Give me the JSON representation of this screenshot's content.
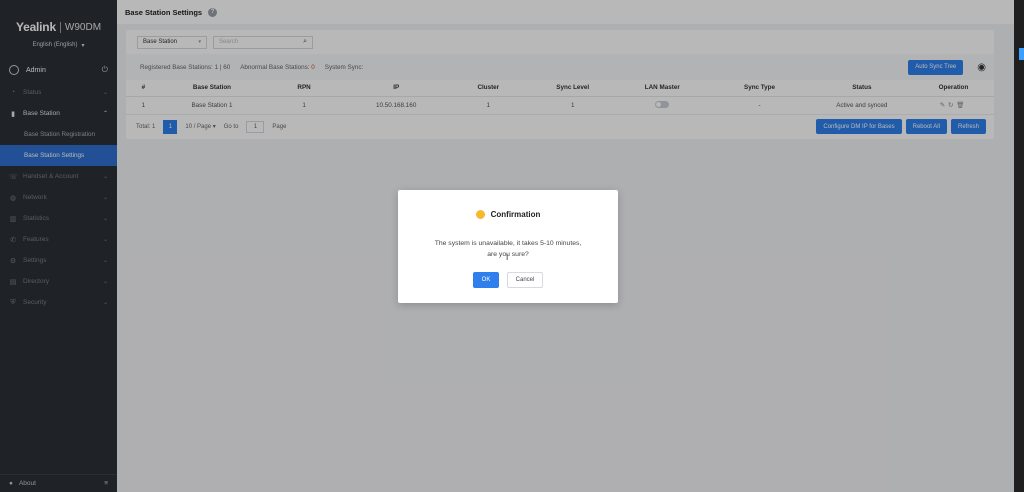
{
  "sidebar": {
    "brand_logo": "Yealink",
    "brand_model": "W90DM",
    "language": "English (English)",
    "user": "Admin",
    "items": [
      {
        "label": "Status",
        "icon": "monitor-icon"
      },
      {
        "label": "Base Station",
        "icon": "base-station-icon"
      },
      {
        "label": "Handset & Account",
        "icon": "phone-icon"
      },
      {
        "label": "Network",
        "icon": "globe-icon"
      },
      {
        "label": "Statistics",
        "icon": "chart-icon"
      },
      {
        "label": "Features",
        "icon": "feature-icon"
      },
      {
        "label": "Settings",
        "icon": "gear-icon"
      },
      {
        "label": "Directory",
        "icon": "book-icon"
      },
      {
        "label": "Security",
        "icon": "shield-icon"
      }
    ],
    "sub_items": [
      "Base Station Registration",
      "Base Station Settings"
    ],
    "about": "About"
  },
  "main": {
    "title": "Base Station Settings",
    "filter_select": "Base Station",
    "search_placeholder": "Search",
    "stats": {
      "registered_label": "Registered Base Stations:",
      "registered_value": "1 | 60",
      "abnormal_label": "Abnormal Base Stations:",
      "abnormal_value": "0",
      "system_sync_label": "System Sync:"
    },
    "auto_sync_button": "Auto Sync Tree",
    "table": {
      "headers": [
        "#",
        "Base Station",
        "RPN",
        "IP",
        "Cluster",
        "Sync Level",
        "LAN Master",
        "Sync Type",
        "Status",
        "Operation"
      ],
      "rows": [
        {
          "num": "1",
          "base_station": "Base Station 1",
          "rpn": "1",
          "ip": "10.50.168.160",
          "cluster": "1",
          "sync_level": "1",
          "sync_type": "-",
          "status": "Active and synced"
        }
      ]
    },
    "pager": {
      "total": "Total: 1",
      "current_page": "1",
      "per_page": "10 / Page",
      "goto_label": "Go to",
      "goto_value": "1",
      "page_label": "Page"
    },
    "actions": {
      "configure": "Configure DM IP for Bases",
      "reboot": "Reboot All",
      "refresh": "Refresh"
    }
  },
  "dialog": {
    "title": "Confirmation",
    "message_line1": "The system is unavailable, it takes 5-10 minutes,",
    "message_line2": "are you sure?",
    "ok": "OK",
    "cancel": "Cancel"
  }
}
